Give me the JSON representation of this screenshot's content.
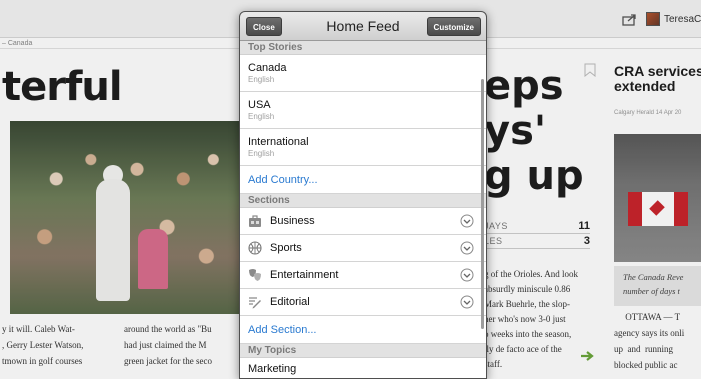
{
  "background": {
    "user_name": "TeresaC",
    "breadcrumb": "– Canada",
    "headline_left": "terful",
    "col1_text": "y it will. Caleb Wat-\n, Gerry Lester Watson,\ntmown in golf courses",
    "col2_text": "around the world as \"Bu\nhad just claimed the M\ngreen jacket for the seco",
    "headline_mid": "eps\nys'\ng up",
    "stats": [
      {
        "label": "JAYS",
        "value": "11"
      },
      {
        "label": "LES",
        "value": "3"
      }
    ],
    "mid_text": "g of the Orioles. And look\nabsurdly miniscule 0.86\nMark Buehrle, the slop-\nher who's now 3-0 just\no weeks into the season,\nlly de facto ace of the\nstaff.",
    "right_title": "CRA services\nextended",
    "right_meta": "Calgary Herald  14 Apr 20",
    "right_caption": "The Canada Reve\nnumber of days t",
    "right_text": "     OTTAWA — T\nagency says its onli\nup  and  running\nblocked public ac"
  },
  "popover": {
    "title": "Home Feed",
    "close_label": "Close",
    "customize_label": "Customize",
    "top_stories_header": "Top Stories",
    "countries": [
      {
        "name": "Canada",
        "language": "English"
      },
      {
        "name": "USA",
        "language": "English"
      },
      {
        "name": "International",
        "language": "English"
      }
    ],
    "add_country_label": "Add Country...",
    "sections_header": "Sections",
    "sections": [
      {
        "label": "Business",
        "icon": "briefcase-icon"
      },
      {
        "label": "Sports",
        "icon": "basketball-icon"
      },
      {
        "label": "Entertainment",
        "icon": "theater-masks-icon"
      },
      {
        "label": "Editorial",
        "icon": "pencil-icon"
      }
    ],
    "add_section_label": "Add Section...",
    "my_topics_header": "My Topics",
    "my_topics_first": "Marketing"
  },
  "colors": {
    "link_blue": "#2a7ad0",
    "accent_green": "#6aa53a",
    "canada_red": "#c9252c"
  }
}
